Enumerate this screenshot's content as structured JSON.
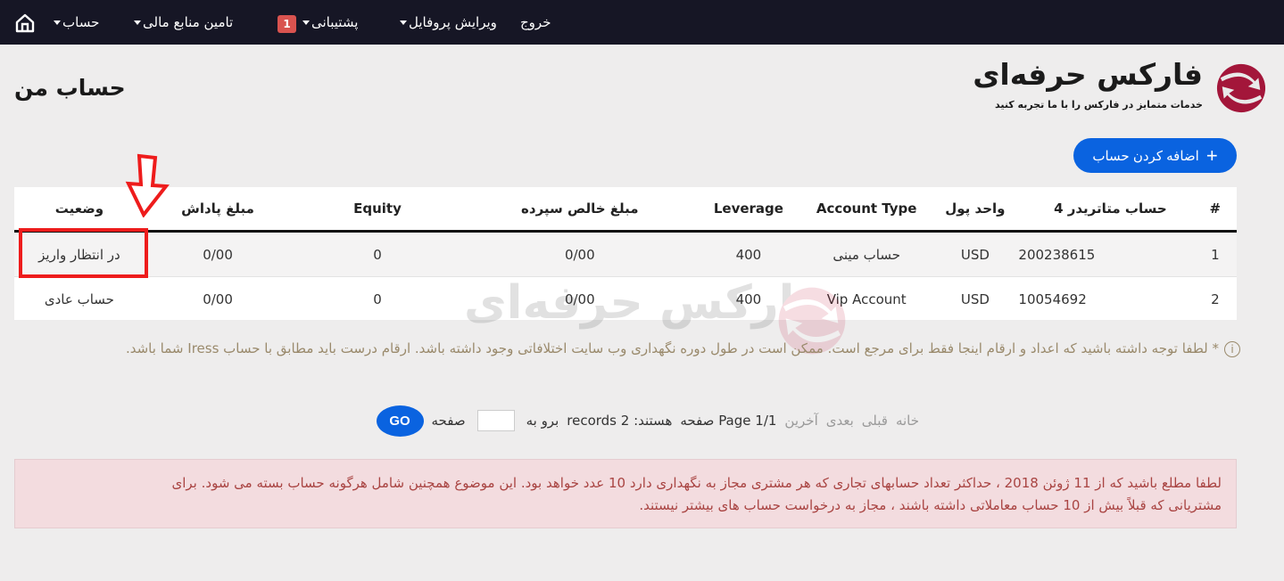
{
  "navbar": {
    "items": [
      {
        "label": "خروج",
        "has_caret": false
      },
      {
        "label": "ویرایش پروفایل",
        "has_caret": true
      },
      {
        "label": "پشتیبانی",
        "has_caret": true,
        "badge": "1"
      },
      {
        "label": "تامین منابع مالی",
        "has_caret": true
      },
      {
        "label": "حساب",
        "has_caret": true
      }
    ],
    "home_icon": "home-icon"
  },
  "page_title": "حساب من",
  "logo": {
    "title": "فارکس حرفه‌ای",
    "subtitle": "خدمات متمایز در فارکس را با ما تجربه کنید"
  },
  "add_account_button": {
    "label": "اضافه کردن حساب",
    "icon": "plus-icon"
  },
  "table": {
    "headers": [
      "#",
      "حساب متاتریدر 4",
      "واحد پول",
      "Account Type",
      "Leverage",
      "مبلغ خالص سپرده",
      "Equity",
      "مبلغ پاداش",
      "وضعیت"
    ],
    "rows": [
      [
        "1",
        "200238615",
        "USD",
        "حساب مینی",
        "400",
        "0/00",
        "0",
        "0/00",
        "در انتظار واریز"
      ],
      [
        "2",
        "10054692",
        "USD",
        "Vip Account",
        "400",
        "0/00",
        "0",
        "0/00",
        "حساب عادی"
      ]
    ]
  },
  "note": "* لطفا توجه داشته باشید که اعداد و ارقام اینجا فقط برای مرجع است. ممکن است در طول دوره نگهداری وب سایت اختلافاتی وجود داشته باشد. ارقام درست باید مطابق با حساب Iress شما باشد.",
  "pagination": {
    "home": "خانه",
    "prev": "قبلی",
    "next": "بعدی",
    "last": "آخرین",
    "page_info": "Page 1/1 صفحه",
    "records": "هستند: records 2",
    "goto_label": "برو به",
    "page_label": "صفحه",
    "goto_value": "",
    "go_button": "GO"
  },
  "alert": {
    "line1": "لطفا مطلع باشید که از 11 ژوئن 2018 ، حداکثر تعداد حسابهای تجاری که هر مشتری مجاز به نگهداری دارد 10 عدد خواهد بود. این موضوع همچنین شامل هرگونه حساب بسته می شود. برای",
    "line2": "مشتریانی که قبلاً بیش از 10 حساب معاملاتی داشته باشند ، مجاز به درخواست حساب های بیشتر نیستند."
  },
  "colors": {
    "navbar_bg": "#161625",
    "primary": "#0a63e0",
    "badge": "#d9534f",
    "alert_bg": "#f3dcdf",
    "alert_text": "#a94442",
    "annotation": "#ee1c1c"
  }
}
